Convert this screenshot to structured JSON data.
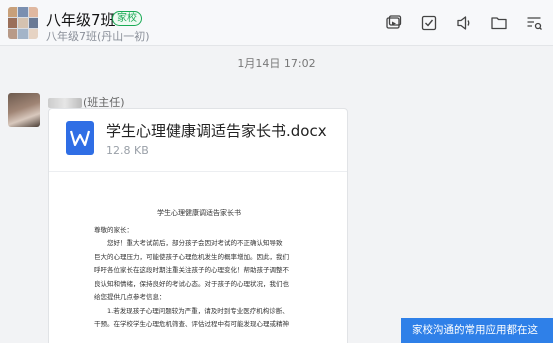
{
  "header": {
    "group_name": "八年级7班",
    "school_tag": "家校",
    "subtitle": "八年级7班(丹山一初)",
    "toolbar_icons": [
      "screen-share-icon",
      "checklist-icon",
      "announcement-icon",
      "folder-icon",
      "list-settings-icon"
    ]
  },
  "chat": {
    "timestamp": "1月14日 17:02",
    "sender": {
      "role_suffix": "(班主任)"
    },
    "file": {
      "name": "学生心理健康调适告家长书.docx",
      "size": "12.8 KB",
      "icon": "word-document-icon",
      "icon_color": "#2f6ee5",
      "preview": {
        "title": "学生心理健康调适告家长书",
        "greeting": "尊敬的家长：",
        "lines": [
          "您好！重大考试前后，部分孩子会因对考试的不正确认知导致",
          "巨大的心理压力，可能使孩子心理危机发生的概率增加。因此，我们",
          "呼吁各位家长在这段时期注重关注孩子的心理变化！帮助孩子调整不",
          "良认知和情绪，保持良好的考试心态。对于孩子的心理状况，我们也",
          "给您提供几点参考信息：",
          "1.若发现孩子心理问题较为严重，请及时到专业医疗机构诊断、",
          "干预。在学校学生心理危机筛查、评估过程中有可能发现心理或精神"
        ]
      }
    }
  },
  "banner": {
    "text": "家校沟通的常用应用都在这",
    "color": "#2f80e8"
  },
  "colors": {
    "school_tag_green": "#1aaa55"
  }
}
